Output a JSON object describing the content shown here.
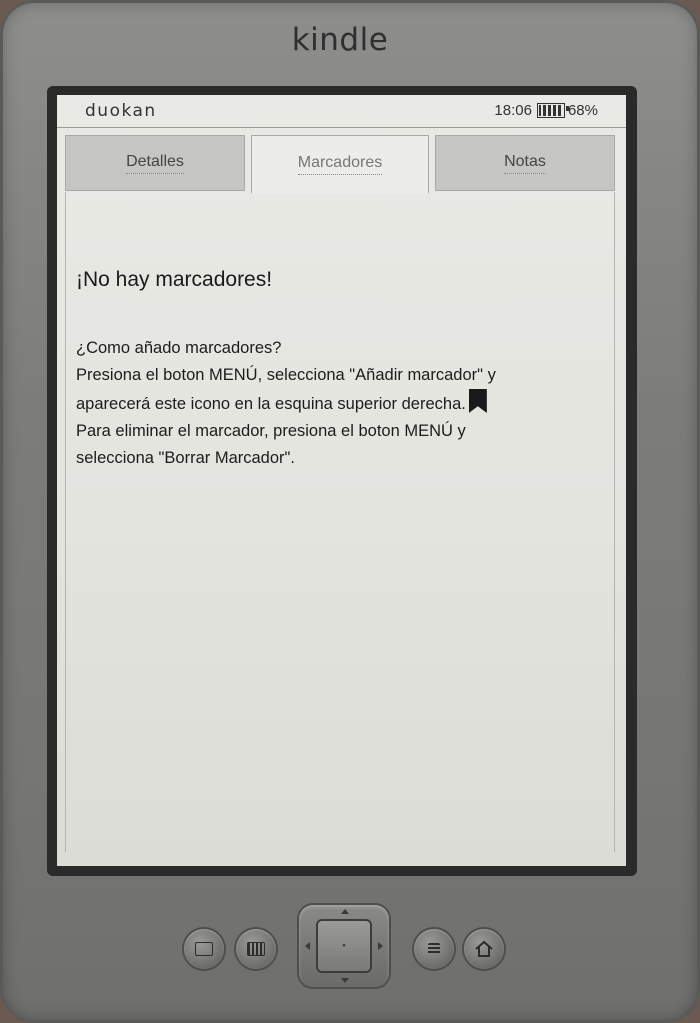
{
  "device": {
    "brand": "kindle"
  },
  "statusbar": {
    "app_name": "duokan",
    "time": "18:06",
    "battery_percent": "68%",
    "battery_level": 0.68
  },
  "tabs": [
    {
      "label": "Detalles",
      "active": false
    },
    {
      "label": "Marcadores",
      "active": true
    },
    {
      "label": "Notas",
      "active": false
    }
  ],
  "content": {
    "empty_title": "¡No hay marcadores!",
    "help_question": "¿Como añado marcadores?",
    "help_line1": "Presiona el boton MENÚ, selecciona \"Añadir marcador\" y",
    "help_line2": "aparecerá este icono en la esquina superior derecha.",
    "help_line3": "Para eliminar el marcador, presiona el boton MENÚ y",
    "help_line4": "selecciona \"Borrar Marcador\"."
  },
  "hardware_buttons": {
    "back": "back-icon",
    "keyboard": "keyboard-icon",
    "menu": "menu-icon",
    "home": "home-icon",
    "select_glyph": "•"
  },
  "colors": {
    "screen": "#e6e6e2",
    "bezel": "#2a2a2a",
    "body": "#7c7c7a"
  }
}
